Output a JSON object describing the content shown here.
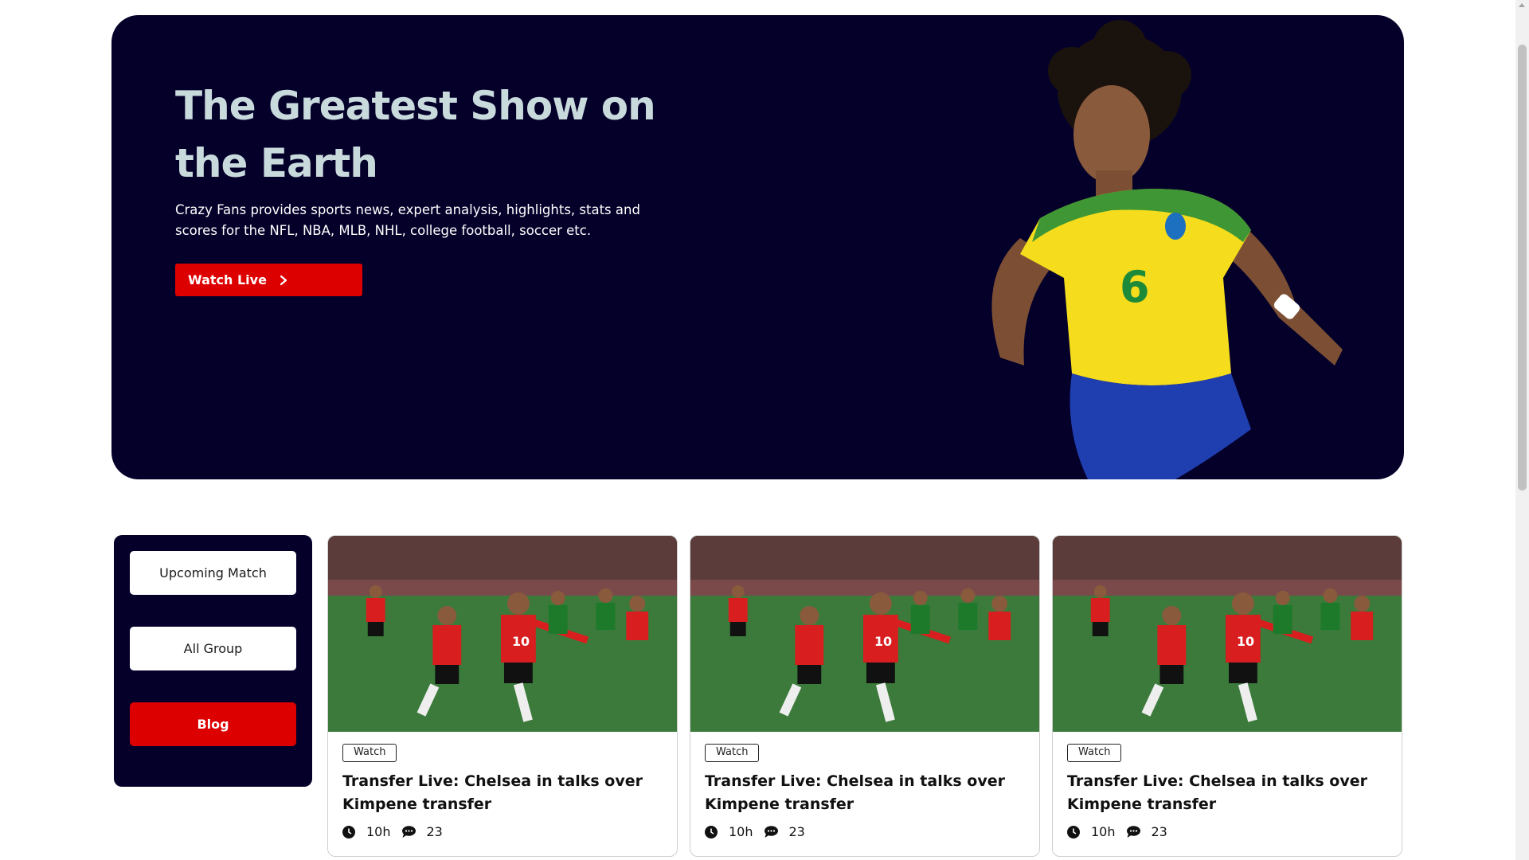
{
  "hero": {
    "title": "The Greatest Show on the Earth",
    "description": "Crazy Fans provides sports news, expert analysis, highlights, stats and scores for the NFL, NBA, MLB, NHL, college football, soccer etc.",
    "cta_label": "Watch Live",
    "cta_icon": "chevron-right-icon",
    "image": "football-player-image",
    "jersey_number": "6"
  },
  "sidebar": {
    "items": [
      {
        "label": "Upcoming Match",
        "active": false
      },
      {
        "label": "All Group",
        "active": false
      },
      {
        "label": "Blog",
        "active": true
      }
    ]
  },
  "cards": [
    {
      "tag": "Watch",
      "title": "Transfer Live: Chelsea in talks over Kimpene transfer",
      "time": "10h",
      "comments": "23",
      "jersey_number": "10"
    },
    {
      "tag": "Watch",
      "title": "Transfer Live: Chelsea in talks over Kimpene transfer",
      "time": "10h",
      "comments": "23",
      "jersey_number": "10"
    },
    {
      "tag": "Watch",
      "title": "Transfer Live: Chelsea in talks over Kimpene transfer",
      "time": "10h",
      "comments": "23",
      "jersey_number": "10"
    }
  ],
  "colors": {
    "navy": "#04002a",
    "accent_red": "#dd0000",
    "title_tint": "#c9dadd"
  }
}
